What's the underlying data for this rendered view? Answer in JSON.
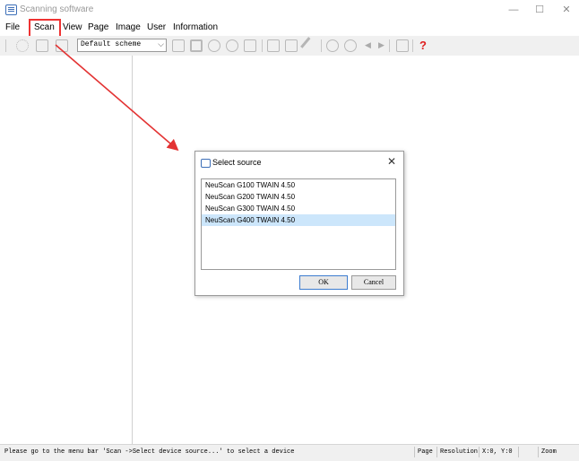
{
  "window": {
    "title": "Scanning software",
    "controls": {
      "minimize": "—",
      "maximize": "☐",
      "close": "✕"
    }
  },
  "menu": [
    "File",
    "Scan",
    "View",
    "Page",
    "Image",
    "User",
    "Information"
  ],
  "toolbar": {
    "scheme_select": "Default scheme",
    "help": "?"
  },
  "dialog": {
    "title": "Select source",
    "close": "✕",
    "sources": [
      "NeuScan G100 TWAIN 4.50",
      "NeuScan G200 TWAIN 4.50",
      "NeuScan G300 TWAIN 4.50",
      "NeuScan G400 TWAIN 4.50"
    ],
    "selected_index": 3,
    "ok": "OK",
    "cancel": "Cancel"
  },
  "status": {
    "message": "Please go to the menu bar 'Scan ->Select device source...' to select a device",
    "page": "Page",
    "resolution": "Resolution",
    "coords": "X:0, Y:0",
    "zoom": "Zoom"
  },
  "colors": {
    "annotation": "#e33333",
    "selection": "#cce6fb",
    "help": "#e02020"
  }
}
